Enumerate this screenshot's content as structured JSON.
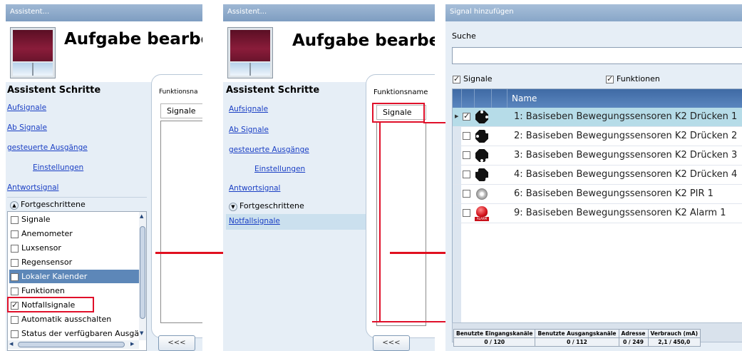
{
  "panel1": {
    "window_title": "Assistent...",
    "header_title": "Aufgabe bearbei",
    "steps_title": "Assistent Schritte",
    "steps": [
      "Aufsignale",
      "Ab Signale",
      "gesteuerte Ausgänge",
      "Einstellungen",
      "Antwortsignal"
    ],
    "advanced_label": "Fortgeschrittene",
    "advanced_items": [
      {
        "label": "Signale",
        "checked": false,
        "selected": false
      },
      {
        "label": "Anemometer",
        "checked": false,
        "selected": false
      },
      {
        "label": "Luxsensor",
        "checked": false,
        "selected": false
      },
      {
        "label": "Regensensor",
        "checked": false,
        "selected": false
      },
      {
        "label": "Lokaler Kalender",
        "checked": false,
        "selected": true
      },
      {
        "label": "Funktionen",
        "checked": false,
        "selected": false
      },
      {
        "label": "Notfallsignale",
        "checked": true,
        "selected": false
      },
      {
        "label": "Automatik ausschalten",
        "checked": false,
        "selected": false
      },
      {
        "label": "Status der verfügbaren Ausgä",
        "checked": false,
        "selected": false
      }
    ],
    "function_label": "Funktionsna",
    "tab_label": "Signale",
    "back_button": "<<<"
  },
  "panel2": {
    "window_title": "Assistent...",
    "header_title": "Aufgabe bearbeite",
    "steps_title": "Assistent Schritte",
    "steps": [
      "Aufsignale",
      "Ab Signale",
      "gesteuerte Ausgänge",
      "Einstellungen",
      "Antwortsignal"
    ],
    "advanced_label": "Fortgeschrittene",
    "active_step": "Notfallsignale",
    "function_label": "Funktionsname",
    "tab_label": "Signale",
    "back_button": "<<<"
  },
  "panel3": {
    "window_title": "Signal hinzufügen",
    "search_label": "Suche",
    "search_value": "",
    "filter_signals": "Signale",
    "filter_functions": "Funktionen",
    "column_name": "Name",
    "rows": [
      {
        "name": "1: Basiseben Bewegungssensoren K2 Drücken 1",
        "checked": true,
        "icon": "push-button-icon",
        "selected": true
      },
      {
        "name": "2: Basiseben Bewegungssensoren K2 Drücken 2",
        "checked": false,
        "icon": "push-button-icon",
        "selected": false
      },
      {
        "name": "3: Basiseben Bewegungssensoren K2 Drücken 3",
        "checked": false,
        "icon": "push-button-icon",
        "selected": false
      },
      {
        "name": "4: Basiseben Bewegungssensoren K2 Drücken 4",
        "checked": false,
        "icon": "push-button-icon",
        "selected": false
      },
      {
        "name": "6: Basiseben Bewegungssensoren K2 PIR 1",
        "checked": false,
        "icon": "pir-sensor-icon",
        "selected": false
      },
      {
        "name": "9: Basiseben Bewegungssensoren K2 Alarm 1",
        "checked": false,
        "icon": "alarm-icon",
        "selected": false
      }
    ],
    "footer": {
      "headers": [
        "Benutzte Eingangskanäle",
        "Benutzte Ausgangskanäle",
        "Adresse",
        "Verbrauch (mA)"
      ],
      "values": [
        "0 / 120",
        "0 / 112",
        "0 / 249",
        "2,1 / 450,0"
      ]
    }
  },
  "icon_labels": {
    "alarm": "ALARM"
  },
  "colors": {
    "annotation_red": "#e0102a",
    "link_blue": "#1a3fc4",
    "selection_blue": "#5d87b8",
    "row_highlight": "#b6dce8"
  }
}
